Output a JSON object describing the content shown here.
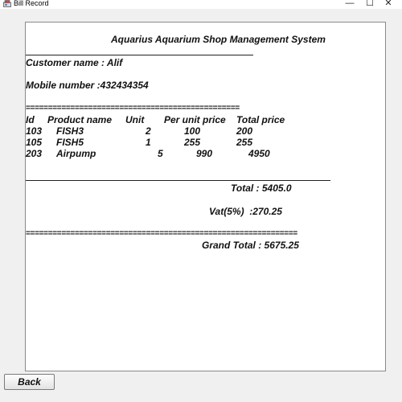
{
  "window": {
    "title": "Bill Record",
    "controls": {
      "minimize": "—",
      "maximize": "☐",
      "close": "✕"
    }
  },
  "bill": {
    "heading": "Aquarius Aquarium Shop Management System",
    "customer_line": "Customer name : Alif",
    "mobile_line": "Mobile number :432434354",
    "separator_top": "================================================",
    "table": {
      "headers": [
        "Id",
        "Product name",
        "Unit",
        "Per unit price",
        "Total price"
      ],
      "rows": [
        [
          "103",
          "FISH3",
          "2",
          "100",
          "200"
        ],
        [
          "105",
          "FISH5",
          "1",
          "255",
          "255"
        ],
        [
          "203",
          "Airpump",
          "5",
          "990",
          "4950"
        ]
      ]
    },
    "total_line": "Total : 5405.0",
    "vat_line": "Vat(5%)  :270.25",
    "separator_bottom": "=============================================================",
    "grand_total_line": "Grand Total : 5675.25"
  },
  "buttons": {
    "back_label": "Back"
  }
}
